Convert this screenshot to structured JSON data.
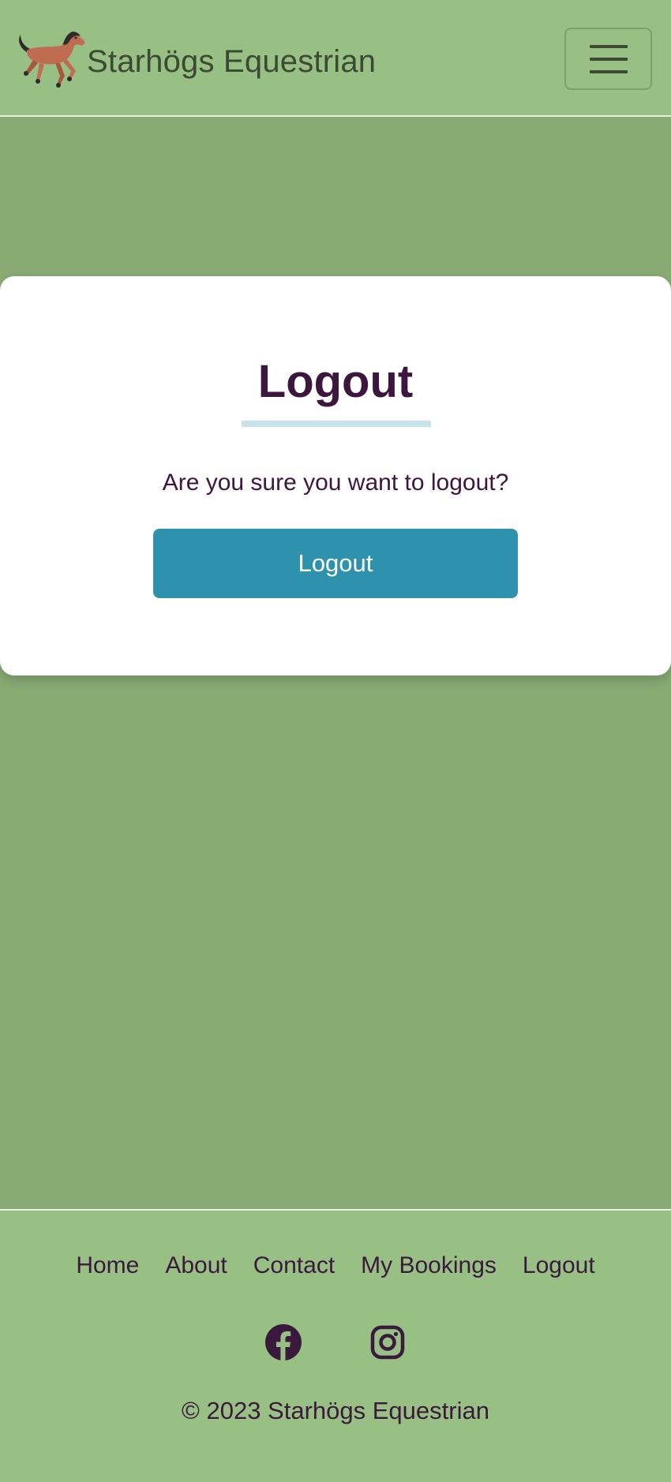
{
  "navbar": {
    "brand_name": "Starhögs Equestrian",
    "logo_icon": "horse-icon",
    "menu_icon": "hamburger-menu-icon"
  },
  "card": {
    "title": "Logout",
    "message": "Are you sure you want to logout?",
    "button_label": "Logout"
  },
  "footer": {
    "links": [
      "Home",
      "About",
      "Contact",
      "My Bookings",
      "Logout"
    ],
    "social_icons": [
      "facebook-icon",
      "instagram-icon"
    ],
    "copyright": "© 2023 Starhögs Equestrian"
  },
  "colors": {
    "header_green": "#98bf84",
    "page_green": "#88ab74",
    "button_blue": "#2e91ad",
    "text_purple": "#3d1640",
    "underline": "#c6e2ea"
  }
}
